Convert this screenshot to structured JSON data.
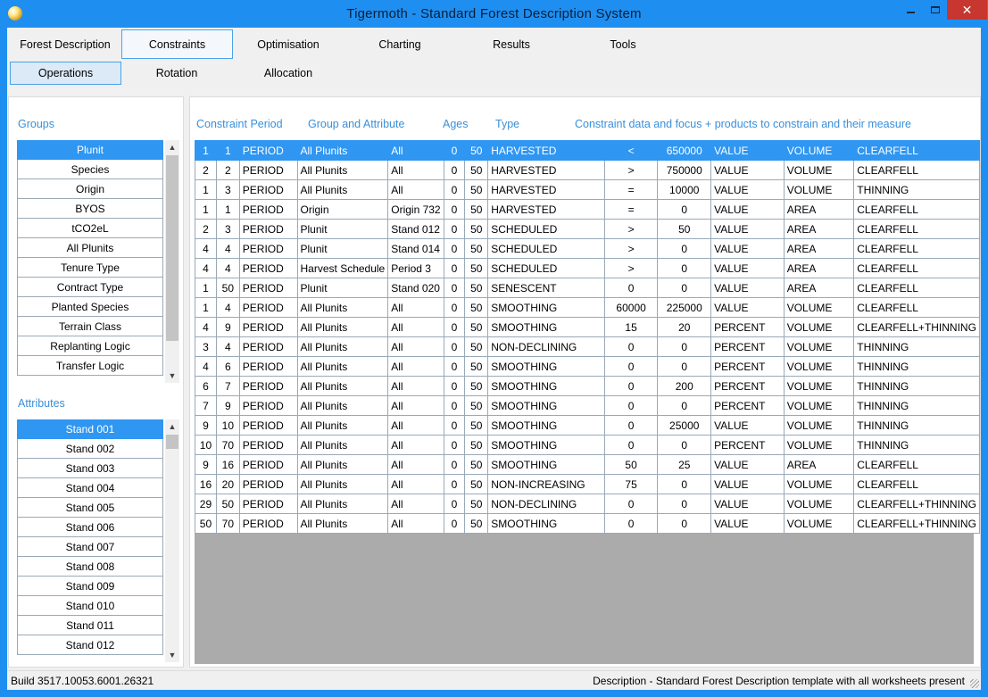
{
  "window": {
    "title": "Tigermoth - Standard Forest Description System",
    "controls": {
      "minimize": "minimize-icon",
      "maximize": "maximize-icon",
      "close": "✕"
    }
  },
  "main_tabs": [
    "Forest Description",
    "Constraints",
    "Optimisation",
    "Charting",
    "Results",
    "Tools"
  ],
  "main_tab_selected": "Constraints",
  "sub_tabs": [
    "Operations",
    "Rotation",
    "Allocation"
  ],
  "sub_tab_selected": "Operations",
  "groups": {
    "label": "Groups",
    "items": [
      "Plunit",
      "Species",
      "Origin",
      "BYOS",
      "tCO2eL",
      "All Plunits",
      "Tenure Type",
      "Contract Type",
      "Planted Species",
      "Terrain Class",
      "Replanting Logic",
      "Transfer Logic"
    ],
    "selected": "Plunit"
  },
  "attributes": {
    "label": "Attributes",
    "items": [
      "Stand 001",
      "Stand 002",
      "Stand 003",
      "Stand 004",
      "Stand 005",
      "Stand 006",
      "Stand 007",
      "Stand 008",
      "Stand 009",
      "Stand 010",
      "Stand 011",
      "Stand 012"
    ],
    "selected": "Stand 001"
  },
  "grid": {
    "headers": {
      "period": "Constraint Period",
      "group": "Group and Attribute",
      "ages": "Ages",
      "type": "Type",
      "data": "Constraint data and focus + products to constrain and their measure"
    },
    "selected_row": 0,
    "rows": [
      [
        "1",
        "1",
        "PERIOD",
        "All Plunits",
        "All",
        "0",
        "50",
        "HARVESTED",
        "<",
        "650000",
        "VALUE",
        "VOLUME",
        "CLEARFELL"
      ],
      [
        "2",
        "2",
        "PERIOD",
        "All Plunits",
        "All",
        "0",
        "50",
        "HARVESTED",
        ">",
        "750000",
        "VALUE",
        "VOLUME",
        "CLEARFELL"
      ],
      [
        "1",
        "3",
        "PERIOD",
        "All Plunits",
        "All",
        "0",
        "50",
        "HARVESTED",
        "=",
        "10000",
        "VALUE",
        "VOLUME",
        "THINNING"
      ],
      [
        "1",
        "1",
        "PERIOD",
        "Origin",
        "Origin 732",
        "0",
        "50",
        "HARVESTED",
        "=",
        "0",
        "VALUE",
        "AREA",
        "CLEARFELL"
      ],
      [
        "2",
        "3",
        "PERIOD",
        "Plunit",
        "Stand 012",
        "0",
        "50",
        "SCHEDULED",
        ">",
        "50",
        "VALUE",
        "AREA",
        "CLEARFELL"
      ],
      [
        "4",
        "4",
        "PERIOD",
        "Plunit",
        "Stand 014",
        "0",
        "50",
        "SCHEDULED",
        ">",
        "0",
        "VALUE",
        "AREA",
        "CLEARFELL"
      ],
      [
        "4",
        "4",
        "PERIOD",
        "Harvest Schedule",
        "Period 3",
        "0",
        "50",
        "SCHEDULED",
        ">",
        "0",
        "VALUE",
        "AREA",
        "CLEARFELL"
      ],
      [
        "1",
        "50",
        "PERIOD",
        "Plunit",
        "Stand 020",
        "0",
        "50",
        "SENESCENT",
        "0",
        "0",
        "VALUE",
        "AREA",
        "CLEARFELL"
      ],
      [
        "1",
        "4",
        "PERIOD",
        "All Plunits",
        "All",
        "0",
        "50",
        "SMOOTHING",
        "60000",
        "225000",
        "VALUE",
        "VOLUME",
        "CLEARFELL"
      ],
      [
        "4",
        "9",
        "PERIOD",
        "All Plunits",
        "All",
        "0",
        "50",
        "SMOOTHING",
        "15",
        "20",
        "PERCENT",
        "VOLUME",
        "CLEARFELL+THINNING"
      ],
      [
        "3",
        "4",
        "PERIOD",
        "All Plunits",
        "All",
        "0",
        "50",
        "NON-DECLINING",
        "0",
        "0",
        "PERCENT",
        "VOLUME",
        "THINNING"
      ],
      [
        "4",
        "6",
        "PERIOD",
        "All Plunits",
        "All",
        "0",
        "50",
        "SMOOTHING",
        "0",
        "0",
        "PERCENT",
        "VOLUME",
        "THINNING"
      ],
      [
        "6",
        "7",
        "PERIOD",
        "All Plunits",
        "All",
        "0",
        "50",
        "SMOOTHING",
        "0",
        "200",
        "PERCENT",
        "VOLUME",
        "THINNING"
      ],
      [
        "7",
        "9",
        "PERIOD",
        "All Plunits",
        "All",
        "0",
        "50",
        "SMOOTHING",
        "0",
        "0",
        "PERCENT",
        "VOLUME",
        "THINNING"
      ],
      [
        "9",
        "10",
        "PERIOD",
        "All Plunits",
        "All",
        "0",
        "50",
        "SMOOTHING",
        "0",
        "25000",
        "VALUE",
        "VOLUME",
        "THINNING"
      ],
      [
        "10",
        "70",
        "PERIOD",
        "All Plunits",
        "All",
        "0",
        "50",
        "SMOOTHING",
        "0",
        "0",
        "PERCENT",
        "VOLUME",
        "THINNING"
      ],
      [
        "9",
        "16",
        "PERIOD",
        "All Plunits",
        "All",
        "0",
        "50",
        "SMOOTHING",
        "50",
        "25",
        "VALUE",
        "AREA",
        "CLEARFELL"
      ],
      [
        "16",
        "20",
        "PERIOD",
        "All Plunits",
        "All",
        "0",
        "50",
        "NON-INCREASING",
        "75",
        "0",
        "VALUE",
        "VOLUME",
        "CLEARFELL"
      ],
      [
        "29",
        "50",
        "PERIOD",
        "All Plunits",
        "All",
        "0",
        "50",
        "NON-DECLINING",
        "0",
        "0",
        "VALUE",
        "VOLUME",
        "CLEARFELL+THINNING"
      ],
      [
        "50",
        "70",
        "PERIOD",
        "All Plunits",
        "All",
        "0",
        "50",
        "SMOOTHING",
        "0",
        "0",
        "VALUE",
        "VOLUME",
        "CLEARFELL+THINNING"
      ]
    ]
  },
  "status": {
    "build": "Build 3517.10053.6001.26321",
    "description": "Description - Standard Forest Description template with all worksheets present"
  }
}
